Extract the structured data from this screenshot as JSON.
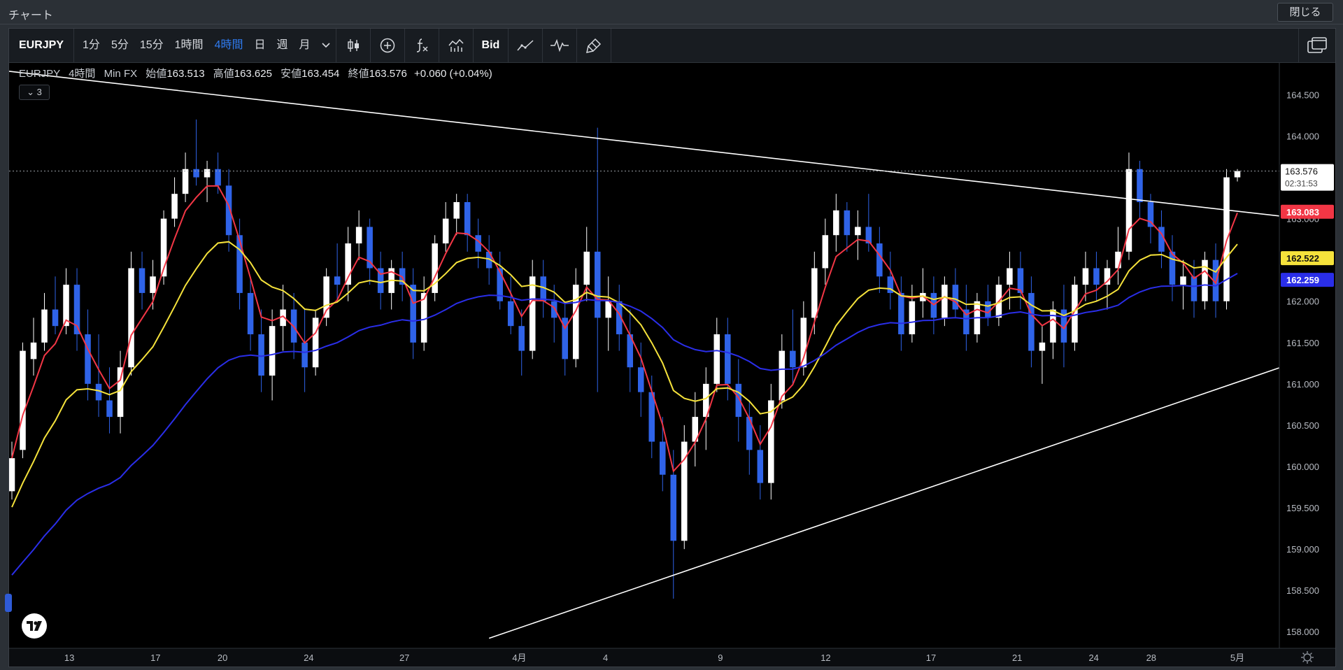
{
  "window": {
    "title": "チャート",
    "close_label": "閉じる"
  },
  "toolbar": {
    "symbol": "EURJPY",
    "intervals": [
      "1分",
      "5分",
      "15分",
      "1時間",
      "4時間",
      "日",
      "週",
      "月"
    ],
    "active_interval": "4時間",
    "bid_label": "Bid",
    "icons": [
      "chevron-down-icon",
      "candlestick-icon",
      "plus-circle-icon",
      "function-icon",
      "indicators-icon",
      "line-chart-icon",
      "pulse-icon",
      "brush-icon",
      "windows-icon"
    ]
  },
  "legend": {
    "symbol": "EURJPY",
    "interval": "4時間",
    "source": "Min FX",
    "open_label": "始値",
    "open": "163.513",
    "high_label": "高値",
    "high": "163.625",
    "low_label": "安値",
    "low": "163.454",
    "close_label": "終値",
    "close": "163.576",
    "change": "+0.060 (+0.04%)",
    "collapse_count": "3"
  },
  "price_axis": {
    "ticks": [
      "164.500",
      "164.000",
      "163.500",
      "163.000",
      "162.500",
      "162.000",
      "161.500",
      "161.000",
      "160.500",
      "160.000",
      "159.500",
      "159.000",
      "158.500",
      "158.000"
    ],
    "last_price": "163.576",
    "countdown": "02:31:53",
    "ma_labels": [
      {
        "value": "163.083",
        "color": "#f23645"
      },
      {
        "value": "162.522",
        "color": "#f5e23b"
      },
      {
        "value": "162.259",
        "color": "#2a2ee8"
      }
    ]
  },
  "time_axis": {
    "ticks": [
      "13",
      "17",
      "20",
      "24",
      "27",
      "4月",
      "4",
      "9",
      "12",
      "17",
      "21",
      "24",
      "28",
      "5月"
    ]
  },
  "colors": {
    "up": "#ffffff",
    "down": "#2f63e8",
    "ma_fast": "#f23645",
    "ma_mid": "#f5e23b",
    "ma_slow": "#2a2ee8",
    "trendline": "#ffffff"
  },
  "chart_data": {
    "type": "candlestick",
    "ylim": [
      157.9,
      164.8
    ],
    "series": [
      {
        "name": "EURJPY",
        "values": [
          {
            "o": 159.7,
            "h": 160.3,
            "l": 159.6,
            "c": 160.1
          },
          {
            "o": 160.2,
            "h": 161.5,
            "l": 160.1,
            "c": 161.4
          },
          {
            "o": 161.3,
            "h": 161.8,
            "l": 161.1,
            "c": 161.5
          },
          {
            "o": 161.5,
            "h": 162.1,
            "l": 161.4,
            "c": 161.9
          },
          {
            "o": 161.9,
            "h": 162.3,
            "l": 161.6,
            "c": 161.7
          },
          {
            "o": 161.7,
            "h": 162.4,
            "l": 161.6,
            "c": 162.2
          },
          {
            "o": 162.2,
            "h": 162.4,
            "l": 161.4,
            "c": 161.6
          },
          {
            "o": 161.6,
            "h": 161.9,
            "l": 160.8,
            "c": 161.0
          },
          {
            "o": 161.0,
            "h": 161.6,
            "l": 160.6,
            "c": 160.8
          },
          {
            "o": 160.8,
            "h": 161.2,
            "l": 160.4,
            "c": 160.6
          },
          {
            "o": 160.6,
            "h": 161.4,
            "l": 160.4,
            "c": 161.2
          },
          {
            "o": 161.2,
            "h": 162.6,
            "l": 161.1,
            "c": 162.4
          },
          {
            "o": 162.4,
            "h": 162.6,
            "l": 161.9,
            "c": 162.1
          },
          {
            "o": 162.1,
            "h": 162.5,
            "l": 161.9,
            "c": 162.3
          },
          {
            "o": 162.3,
            "h": 163.1,
            "l": 162.2,
            "c": 163.0
          },
          {
            "o": 163.0,
            "h": 163.5,
            "l": 162.9,
            "c": 163.3
          },
          {
            "o": 163.3,
            "h": 163.8,
            "l": 163.2,
            "c": 163.6
          },
          {
            "o": 163.6,
            "h": 164.2,
            "l": 163.4,
            "c": 163.5
          },
          {
            "o": 163.5,
            "h": 163.7,
            "l": 163.2,
            "c": 163.6
          },
          {
            "o": 163.6,
            "h": 163.8,
            "l": 163.3,
            "c": 163.4
          },
          {
            "o": 163.4,
            "h": 163.6,
            "l": 162.6,
            "c": 162.8
          },
          {
            "o": 162.8,
            "h": 163.0,
            "l": 161.9,
            "c": 162.1
          },
          {
            "o": 162.1,
            "h": 162.3,
            "l": 161.4,
            "c": 161.6
          },
          {
            "o": 161.6,
            "h": 161.9,
            "l": 160.9,
            "c": 161.1
          },
          {
            "o": 161.1,
            "h": 161.9,
            "l": 160.8,
            "c": 161.7
          },
          {
            "o": 161.7,
            "h": 162.2,
            "l": 161.4,
            "c": 161.9
          },
          {
            "o": 161.9,
            "h": 162.1,
            "l": 161.3,
            "c": 161.5
          },
          {
            "o": 161.5,
            "h": 161.9,
            "l": 160.9,
            "c": 161.2
          },
          {
            "o": 161.2,
            "h": 161.9,
            "l": 161.1,
            "c": 161.8
          },
          {
            "o": 161.8,
            "h": 162.4,
            "l": 161.7,
            "c": 162.3
          },
          {
            "o": 162.3,
            "h": 162.7,
            "l": 162.0,
            "c": 162.2
          },
          {
            "o": 162.2,
            "h": 162.9,
            "l": 162.0,
            "c": 162.7
          },
          {
            "o": 162.7,
            "h": 163.1,
            "l": 162.5,
            "c": 162.9
          },
          {
            "o": 162.9,
            "h": 163.0,
            "l": 162.2,
            "c": 162.4
          },
          {
            "o": 162.4,
            "h": 162.6,
            "l": 161.9,
            "c": 162.1
          },
          {
            "o": 162.1,
            "h": 162.5,
            "l": 161.9,
            "c": 162.4
          },
          {
            "o": 162.4,
            "h": 162.6,
            "l": 162.0,
            "c": 162.2
          },
          {
            "o": 162.2,
            "h": 162.4,
            "l": 161.3,
            "c": 161.5
          },
          {
            "o": 161.5,
            "h": 162.3,
            "l": 161.4,
            "c": 162.1
          },
          {
            "o": 162.1,
            "h": 162.8,
            "l": 162.0,
            "c": 162.7
          },
          {
            "o": 162.7,
            "h": 163.2,
            "l": 162.6,
            "c": 163.0
          },
          {
            "o": 163.0,
            "h": 163.3,
            "l": 162.8,
            "c": 163.2
          },
          {
            "o": 163.2,
            "h": 163.3,
            "l": 162.6,
            "c": 162.8
          },
          {
            "o": 162.8,
            "h": 163.0,
            "l": 162.4,
            "c": 162.6
          },
          {
            "o": 162.6,
            "h": 162.8,
            "l": 162.2,
            "c": 162.4
          },
          {
            "o": 162.4,
            "h": 162.6,
            "l": 161.9,
            "c": 162.0
          },
          {
            "o": 162.0,
            "h": 162.3,
            "l": 161.6,
            "c": 161.7
          },
          {
            "o": 161.7,
            "h": 161.9,
            "l": 161.1,
            "c": 161.4
          },
          {
            "o": 161.4,
            "h": 162.5,
            "l": 161.3,
            "c": 162.3
          },
          {
            "o": 162.3,
            "h": 162.5,
            "l": 161.8,
            "c": 162.0
          },
          {
            "o": 162.0,
            "h": 162.2,
            "l": 161.5,
            "c": 161.8
          },
          {
            "o": 161.8,
            "h": 162.0,
            "l": 161.1,
            "c": 161.3
          },
          {
            "o": 161.3,
            "h": 162.4,
            "l": 161.2,
            "c": 162.2
          },
          {
            "o": 162.2,
            "h": 162.9,
            "l": 162.0,
            "c": 162.6
          },
          {
            "o": 162.6,
            "h": 164.1,
            "l": 160.9,
            "c": 161.8
          },
          {
            "o": 161.8,
            "h": 162.3,
            "l": 161.4,
            "c": 162.0
          },
          {
            "o": 162.0,
            "h": 162.2,
            "l": 161.4,
            "c": 161.6
          },
          {
            "o": 161.6,
            "h": 161.9,
            "l": 160.9,
            "c": 161.2
          },
          {
            "o": 161.2,
            "h": 161.5,
            "l": 160.6,
            "c": 160.9
          },
          {
            "o": 160.9,
            "h": 161.1,
            "l": 160.1,
            "c": 160.3
          },
          {
            "o": 160.3,
            "h": 160.6,
            "l": 159.7,
            "c": 159.9
          },
          {
            "o": 159.9,
            "h": 160.2,
            "l": 158.4,
            "c": 159.1
          },
          {
            "o": 159.1,
            "h": 160.5,
            "l": 159.0,
            "c": 160.3
          },
          {
            "o": 160.3,
            "h": 160.9,
            "l": 160.0,
            "c": 160.6
          },
          {
            "o": 160.6,
            "h": 161.2,
            "l": 160.2,
            "c": 161.0
          },
          {
            "o": 161.0,
            "h": 161.8,
            "l": 160.9,
            "c": 161.6
          },
          {
            "o": 161.6,
            "h": 161.8,
            "l": 160.8,
            "c": 161.0
          },
          {
            "o": 161.0,
            "h": 161.3,
            "l": 160.3,
            "c": 160.6
          },
          {
            "o": 160.6,
            "h": 160.8,
            "l": 159.9,
            "c": 160.2
          },
          {
            "o": 160.2,
            "h": 160.5,
            "l": 159.6,
            "c": 159.8
          },
          {
            "o": 159.8,
            "h": 161.0,
            "l": 159.6,
            "c": 160.8
          },
          {
            "o": 160.8,
            "h": 161.6,
            "l": 160.7,
            "c": 161.4
          },
          {
            "o": 161.4,
            "h": 161.9,
            "l": 161.0,
            "c": 161.2
          },
          {
            "o": 161.2,
            "h": 162.0,
            "l": 161.1,
            "c": 161.8
          },
          {
            "o": 161.8,
            "h": 162.6,
            "l": 161.6,
            "c": 162.4
          },
          {
            "o": 162.4,
            "h": 163.0,
            "l": 162.2,
            "c": 162.8
          },
          {
            "o": 162.8,
            "h": 163.3,
            "l": 162.6,
            "c": 163.1
          },
          {
            "o": 163.1,
            "h": 163.2,
            "l": 162.6,
            "c": 162.8
          },
          {
            "o": 162.8,
            "h": 163.1,
            "l": 162.5,
            "c": 162.9
          },
          {
            "o": 162.9,
            "h": 163.3,
            "l": 162.6,
            "c": 162.7
          },
          {
            "o": 162.7,
            "h": 162.9,
            "l": 162.1,
            "c": 162.3
          },
          {
            "o": 162.3,
            "h": 162.6,
            "l": 161.9,
            "c": 162.1
          },
          {
            "o": 162.1,
            "h": 162.3,
            "l": 161.4,
            "c": 161.6
          },
          {
            "o": 161.6,
            "h": 162.2,
            "l": 161.5,
            "c": 162.0
          },
          {
            "o": 162.0,
            "h": 162.4,
            "l": 161.8,
            "c": 162.1
          },
          {
            "o": 162.1,
            "h": 162.3,
            "l": 161.6,
            "c": 161.8
          },
          {
            "o": 161.8,
            "h": 162.3,
            "l": 161.7,
            "c": 162.2
          },
          {
            "o": 162.2,
            "h": 162.4,
            "l": 161.8,
            "c": 161.9
          },
          {
            "o": 161.9,
            "h": 162.2,
            "l": 161.4,
            "c": 161.6
          },
          {
            "o": 161.6,
            "h": 162.1,
            "l": 161.5,
            "c": 162.0
          },
          {
            "o": 162.0,
            "h": 162.2,
            "l": 161.7,
            "c": 161.8
          },
          {
            "o": 161.8,
            "h": 162.3,
            "l": 161.7,
            "c": 162.2
          },
          {
            "o": 162.2,
            "h": 162.6,
            "l": 161.9,
            "c": 162.4
          },
          {
            "o": 162.4,
            "h": 162.6,
            "l": 161.9,
            "c": 162.1
          },
          {
            "o": 162.1,
            "h": 162.3,
            "l": 161.2,
            "c": 161.4
          },
          {
            "o": 161.4,
            "h": 161.7,
            "l": 161.0,
            "c": 161.5
          },
          {
            "o": 161.5,
            "h": 162.0,
            "l": 161.3,
            "c": 161.9
          },
          {
            "o": 161.9,
            "h": 162.2,
            "l": 161.2,
            "c": 161.5
          },
          {
            "o": 161.5,
            "h": 162.3,
            "l": 161.4,
            "c": 162.2
          },
          {
            "o": 162.2,
            "h": 162.6,
            "l": 162.0,
            "c": 162.4
          },
          {
            "o": 162.4,
            "h": 162.6,
            "l": 162.0,
            "c": 162.2
          },
          {
            "o": 162.2,
            "h": 162.5,
            "l": 161.9,
            "c": 162.4
          },
          {
            "o": 162.4,
            "h": 162.9,
            "l": 162.2,
            "c": 162.6
          },
          {
            "o": 162.6,
            "h": 163.8,
            "l": 162.5,
            "c": 163.6
          },
          {
            "o": 163.6,
            "h": 163.7,
            "l": 163.0,
            "c": 163.2
          },
          {
            "o": 163.2,
            "h": 163.3,
            "l": 162.7,
            "c": 162.9
          },
          {
            "o": 162.9,
            "h": 163.1,
            "l": 162.4,
            "c": 162.6
          },
          {
            "o": 162.6,
            "h": 162.8,
            "l": 162.0,
            "c": 162.2
          },
          {
            "o": 162.2,
            "h": 162.5,
            "l": 161.9,
            "c": 162.3
          },
          {
            "o": 162.3,
            "h": 162.5,
            "l": 161.8,
            "c": 162.0
          },
          {
            "o": 162.0,
            "h": 162.6,
            "l": 161.9,
            "c": 162.5
          },
          {
            "o": 162.5,
            "h": 162.7,
            "l": 161.8,
            "c": 162.0
          },
          {
            "o": 162.0,
            "h": 163.6,
            "l": 161.9,
            "c": 163.5
          },
          {
            "o": 163.5,
            "h": 163.6,
            "l": 163.45,
            "c": 163.576
          }
        ]
      },
      {
        "name": "MA fast",
        "value": 163.083
      },
      {
        "name": "MA mid",
        "value": 162.522
      },
      {
        "name": "MA slow",
        "value": 162.259
      }
    ],
    "trendlines": [
      {
        "from": {
          "bar": 0,
          "price": 164.78
        },
        "to": {
          "bar": 117,
          "price": 163.03
        }
      },
      {
        "from": {
          "bar": 44,
          "price": 157.92
        },
        "to": {
          "bar": 117,
          "price": 161.2
        }
      }
    ],
    "grid": false
  }
}
